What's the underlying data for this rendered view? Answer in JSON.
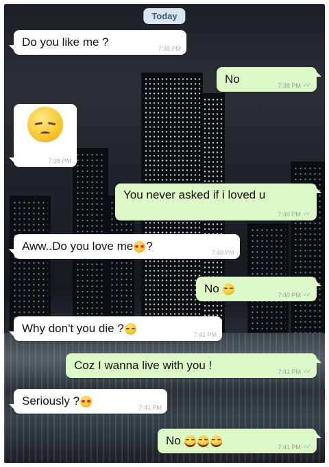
{
  "chat": {
    "date_label": "Today",
    "messages": [
      {
        "direction": "incoming",
        "text": "Do you like me ?",
        "time": "7:38 PM"
      },
      {
        "direction": "outgoing",
        "text": "No",
        "time": "7:38 PM",
        "status": "read"
      },
      {
        "direction": "incoming",
        "text": "",
        "emoji": [
          "pensive-face-emoji"
        ],
        "time": "7:38 PM"
      },
      {
        "direction": "outgoing",
        "text": "You never asked if i loved u",
        "time": "7:40 PM",
        "status": "read"
      },
      {
        "direction": "incoming",
        "text": "Aww..Do you love me",
        "text_after": " ?",
        "emoji": [
          "heart-eyes-emoji"
        ],
        "time": "7:40 PM"
      },
      {
        "direction": "outgoing",
        "text": "No",
        "emoji": [
          "smile-emoji"
        ],
        "time": "7:40 PM",
        "status": "read"
      },
      {
        "direction": "incoming",
        "text": "Why don't you die ?",
        "emoji": [
          "sad-face-emoji"
        ],
        "time": "7:41 PM"
      },
      {
        "direction": "outgoing",
        "text": "Coz I wanna live with you !",
        "time": "7:41 PM",
        "status": "read"
      },
      {
        "direction": "incoming",
        "text": "Seriously ?",
        "emoji": [
          "heart-eyes-emoji"
        ],
        "time": "7:41 PM"
      },
      {
        "direction": "outgoing",
        "text": "No",
        "emoji": [
          "tears-of-joy-emoji",
          "tears-of-joy-emoji",
          "tears-of-joy-emoji"
        ],
        "time": "7:41 PM",
        "status": "read"
      }
    ]
  },
  "colors": {
    "incoming_bubble": "#ffffff",
    "outgoing_bubble": "#dcf8c6",
    "date_pill": "#d6e6f3",
    "read_ticks": "#8fb3c9"
  }
}
